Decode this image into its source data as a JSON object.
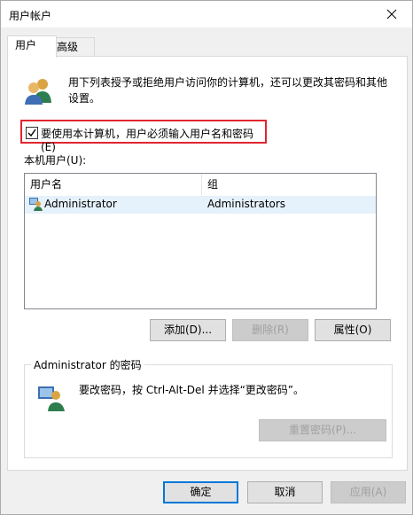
{
  "window": {
    "title": "用户帐户"
  },
  "tabs": [
    {
      "label": "用户"
    },
    {
      "label": "高级"
    }
  ],
  "users_tab": {
    "intro": "用下列表授予或拒绝用户访问你的计算机，还可以更改其密码和其他设置。",
    "checkbox_label": "要使用本计算机，用户必须输入用户名和密码(E)",
    "checkbox_checked": true,
    "local_users_label": "本机用户(U):",
    "columns": [
      "用户名",
      "组"
    ],
    "rows": [
      {
        "user": "Administrator",
        "group": "Administrators"
      }
    ],
    "buttons": {
      "add": "添加(D)...",
      "remove": "删除(R)",
      "properties": "属性(O)"
    },
    "password_group": {
      "title": "Administrator 的密码",
      "text": "要改密码，按 Ctrl-Alt-Del 并选择“更改密码”。",
      "reset_button": "重置密码(P)..."
    }
  },
  "footer": {
    "ok": "确定",
    "cancel": "取消",
    "apply": "应用(A)"
  },
  "colors": {
    "accent": "#0078d7",
    "highlight_border": "#e0262f"
  }
}
